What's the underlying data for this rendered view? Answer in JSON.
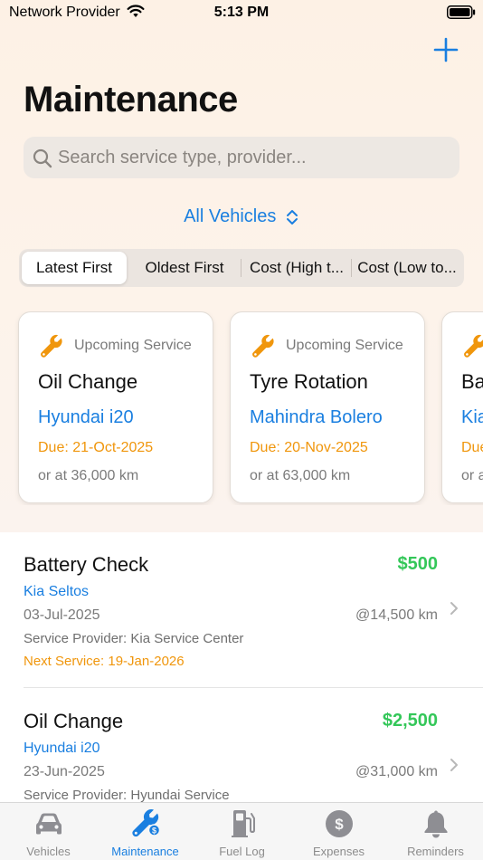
{
  "status_bar": {
    "carrier": "Network Provider",
    "time": "5:13 PM"
  },
  "header": {
    "title": "Maintenance",
    "add_icon": "plus-icon"
  },
  "search": {
    "placeholder": "Search service type, provider...",
    "value": ""
  },
  "vehicle_filter": {
    "label": "All Vehicles",
    "icon": "chevron-up-down-icon"
  },
  "sort_options": [
    "Latest First",
    "Oldest First",
    "Cost (High t...",
    "Cost (Low to..."
  ],
  "sort_selected": "Latest First",
  "upcoming": [
    {
      "label": "Upcoming Service",
      "title": "Oil Change",
      "vehicle": "Hyundai i20",
      "due": "Due: 21-Oct-2025",
      "km": "or at 36,000 km"
    },
    {
      "label": "Upcoming Service",
      "title": "Tyre Rotation",
      "vehicle": "Mahindra Bolero",
      "due": "Due: 20-Nov-2025",
      "km": "or at 63,000 km"
    },
    {
      "label": "Upcoming Service",
      "title": "Ba",
      "vehicle": "Kia",
      "due": "Due",
      "km": "or a"
    }
  ],
  "records": [
    {
      "title": "Battery Check",
      "cost": "$500",
      "vehicle": "Kia Seltos",
      "date": "03-Jul-2025",
      "odometer": "@14,500 km",
      "provider": "Service Provider: Kia Service Center",
      "next_service": "Next Service: 19-Jan-2026"
    },
    {
      "title": "Oil Change",
      "cost": "$2,500",
      "vehicle": "Hyundai i20",
      "date": "23-Jun-2025",
      "odometer": "@31,000 km",
      "provider": "Service Provider: Hyundai Service",
      "next_service": ""
    }
  ],
  "tabs": [
    {
      "label": "Vehicles",
      "icon": "car-icon"
    },
    {
      "label": "Maintenance",
      "icon": "wrench-icon"
    },
    {
      "label": "Fuel Log",
      "icon": "fuel-pump-icon"
    },
    {
      "label": "Expenses",
      "icon": "dollar-coin-icon"
    },
    {
      "label": "Reminders",
      "icon": "bell-icon"
    }
  ],
  "active_tab": "Maintenance",
  "colors": {
    "accent": "#1a7fe0",
    "cost": "#34c759",
    "due": "#f0960c",
    "wrench": "#f0960c"
  }
}
